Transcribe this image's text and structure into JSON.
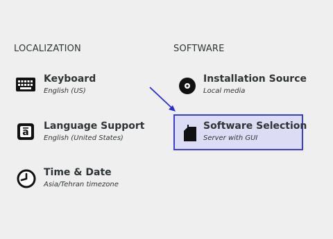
{
  "localization": {
    "title": "LOCALIZATION",
    "keyboard": {
      "label": "Keyboard",
      "status": "English (US)",
      "icon": "keyboard-icon"
    },
    "language": {
      "label": "Language Support",
      "status": "English (United States)",
      "icon": "language-icon"
    },
    "time_date": {
      "label": "Time & Date",
      "status": "Asia/Tehran timezone",
      "icon": "clock-icon"
    }
  },
  "software": {
    "title": "SOFTWARE",
    "installation_source": {
      "label": "Installation Source",
      "status": "Local media",
      "icon": "disc-icon"
    },
    "software_selection": {
      "label": "Software Selection",
      "status": "Server with GUI",
      "icon": "package-icon"
    }
  },
  "colors": {
    "background": "#efefef",
    "text": "#2e3436",
    "highlight_border": "#3b3be0",
    "highlight_fill": "#dcdcf4",
    "annotation_arrow": "#2b2bdd"
  }
}
